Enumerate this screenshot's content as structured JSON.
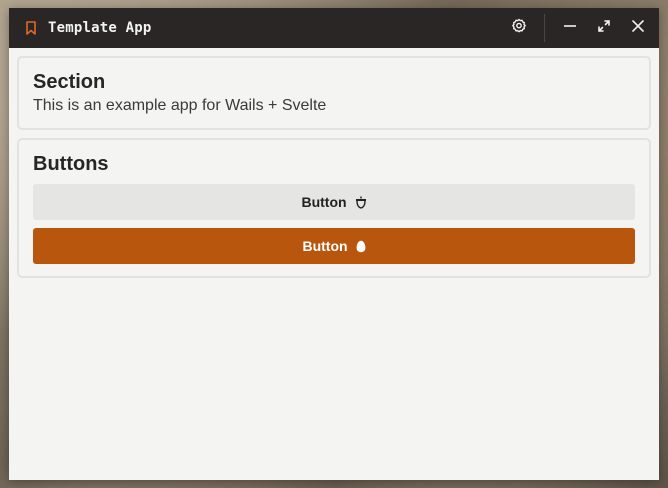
{
  "window": {
    "title": "Template App",
    "icon": "bookmark-icon",
    "controls": [
      "settings-icon",
      "minimize-icon",
      "maximize-icon",
      "close-icon"
    ]
  },
  "section": {
    "heading": "Section",
    "text": "This is an example app for Wails + Svelte"
  },
  "buttons": {
    "heading": "Buttons",
    "secondary_label": "Button",
    "secondary_icon": "acorn-icon",
    "primary_label": "Button",
    "primary_icon": "egg-icon"
  },
  "colors": {
    "accent": "#b8560d",
    "titlebar": "#2a2625",
    "surface": "#f4f4f2",
    "secondary_button": "#e5e5e3",
    "title_icon": "#e0672a"
  }
}
